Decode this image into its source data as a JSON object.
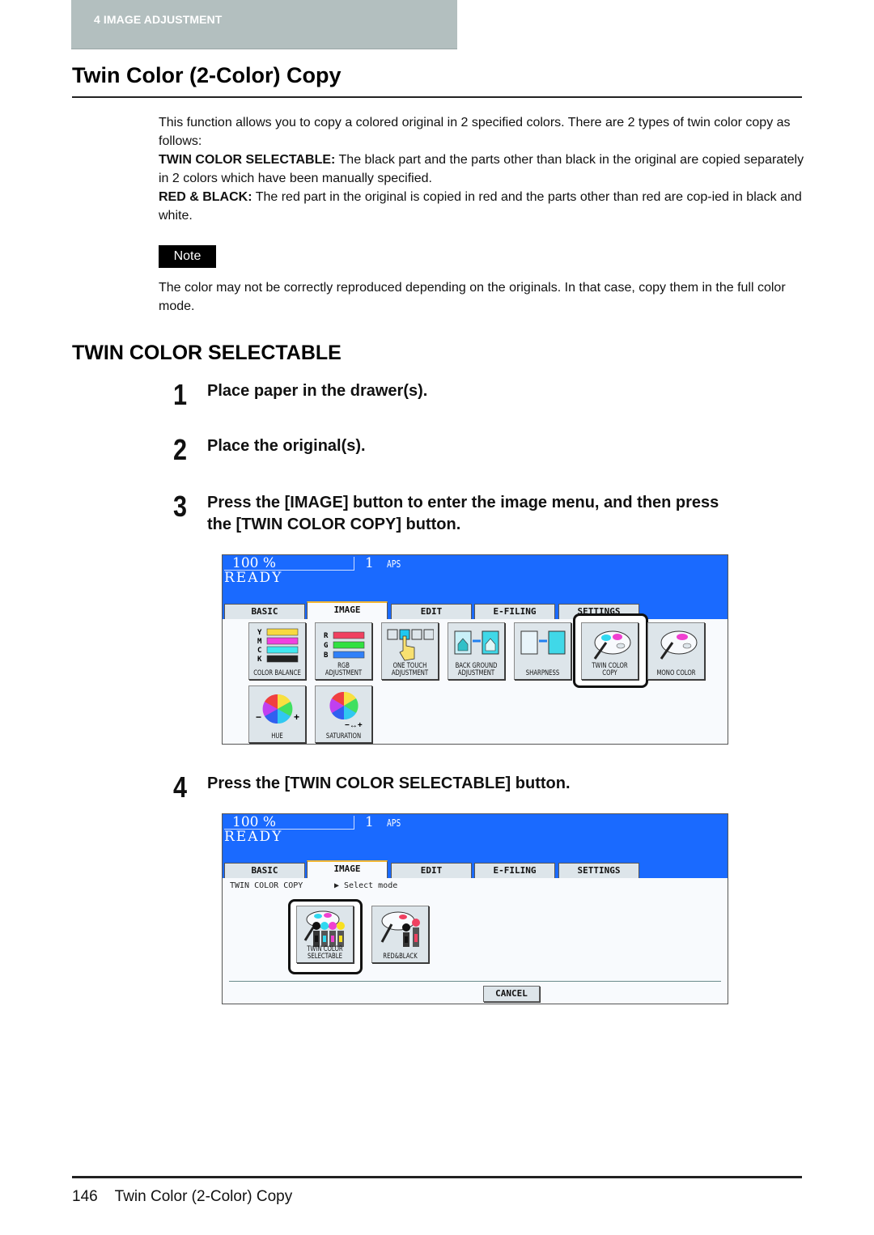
{
  "header": {
    "chapter_tab": "4   IMAGE ADJUSTMENT",
    "page_title": "Twin Color (2-Color) Copy"
  },
  "intro": {
    "p1": "This function allows you to copy a colored original in 2 specified colors. There are 2 types of twin color copy as follows:",
    "p2_term": "TWIN COLOR SELECTABLE:",
    "p2_text": " The black part and the parts other than black in the original are copied separately in 2 colors which have been manually specified.",
    "p3_term": "RED & BLACK:",
    "p3_text": " The red part in the original is copied in red and the parts other than red are cop-ied in black and white."
  },
  "note": {
    "badge": "Note",
    "text": "The color may not be correctly reproduced depending on the originals. In that case, copy them in the full color mode."
  },
  "section": {
    "heading": "TWIN COLOR SELECTABLE"
  },
  "steps": [
    {
      "num": "1",
      "text": "Place paper in the drawer(s)."
    },
    {
      "num": "2",
      "text": "Place the original(s)."
    },
    {
      "num": "3",
      "text_line1": "Press the [IMAGE] button to enter the image menu, and then press",
      "text_line2": "the [TWIN COLOR COPY] button."
    },
    {
      "num": "4",
      "text": "Press the [TWIN COLOR SELECTABLE] button."
    }
  ],
  "screen1": {
    "zoom": "100  %",
    "count": "1",
    "paper": "APS",
    "status": "READY",
    "tabs": [
      "BASIC",
      "IMAGE",
      "EDIT",
      "E-FILING",
      "SETTINGS"
    ],
    "active_tab": "IMAGE",
    "tiles": [
      {
        "label": "COLOR BALANCE",
        "icon": "color-balance-icon"
      },
      {
        "label": "RGB ADJUSTMENT",
        "icon": "rgb-adjustment-icon"
      },
      {
        "label": "ONE TOUCH ADJUSTMENT",
        "icon": "one-touch-icon"
      },
      {
        "label": "BACK GROUND ADJUSTMENT",
        "icon": "background-icon"
      },
      {
        "label": "SHARPNESS",
        "icon": "sharpness-icon"
      },
      {
        "label": "TWIN COLOR COPY",
        "icon": "palette-twin-icon"
      },
      {
        "label": "MONO COLOR",
        "icon": "palette-mono-icon"
      },
      {
        "label": "HUE",
        "icon": "hue-wheel-icon"
      },
      {
        "label": "SATURATION",
        "icon": "saturation-wheel-icon"
      }
    ],
    "highlighted": "TWIN COLOR COPY"
  },
  "screen2": {
    "zoom": "100  %",
    "count": "1",
    "paper": "APS",
    "status": "READY",
    "tabs": [
      "BASIC",
      "IMAGE",
      "EDIT",
      "E-FILING",
      "SETTINGS"
    ],
    "active_tab": "IMAGE",
    "path": "TWIN COLOR COPY",
    "prompt": "▶ Select mode",
    "tiles": [
      {
        "label": "TWIN COLOR SELECTABLE",
        "icon": "twin-selectable-icon"
      },
      {
        "label": "RED&BLACK",
        "icon": "red-black-icon"
      }
    ],
    "highlighted": "TWIN COLOR SELECTABLE",
    "cancel": "CANCEL"
  },
  "footer": {
    "page_number": "146",
    "title": "Twin Color (2-Color) Copy"
  },
  "colors": {
    "screen_blue": "#1a6aff",
    "tab_active_accent": "#f2b632",
    "chapter_tab_bg": "#b3bfbf"
  }
}
